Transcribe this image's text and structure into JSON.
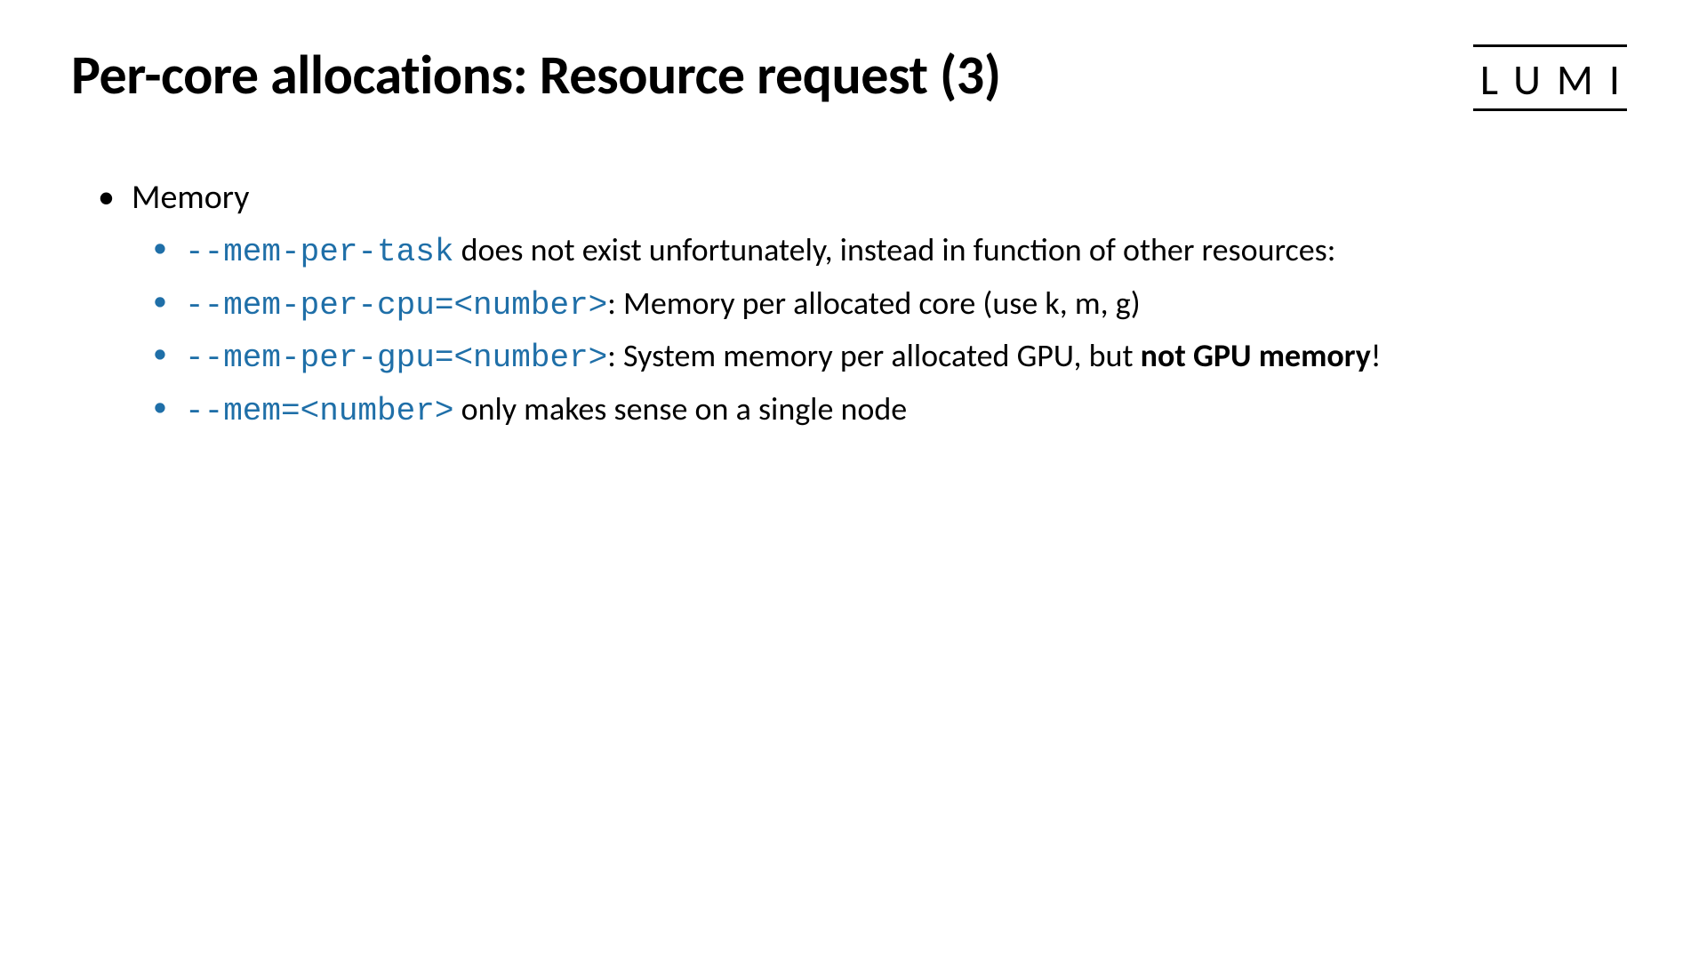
{
  "title": "Per-core allocations: Resource request (3)",
  "logo": "LUMI",
  "bullets": {
    "l1": "Memory",
    "items": [
      {
        "code": "--mem-per-task",
        "text_after": " does not exist unfortunately, instead in function of other resources:"
      },
      {
        "code": "--mem-per-cpu=<number>",
        "text_after": ": Memory per allocated core (use k, m, g)"
      },
      {
        "code": "--mem-per-gpu=<number>",
        "text_before": ": System memory per allocated GPU, but ",
        "bold": "not GPU memory",
        "text_end": "!"
      },
      {
        "code": "--mem=<number>",
        "text_after": " only makes sense on a single node"
      }
    ]
  }
}
